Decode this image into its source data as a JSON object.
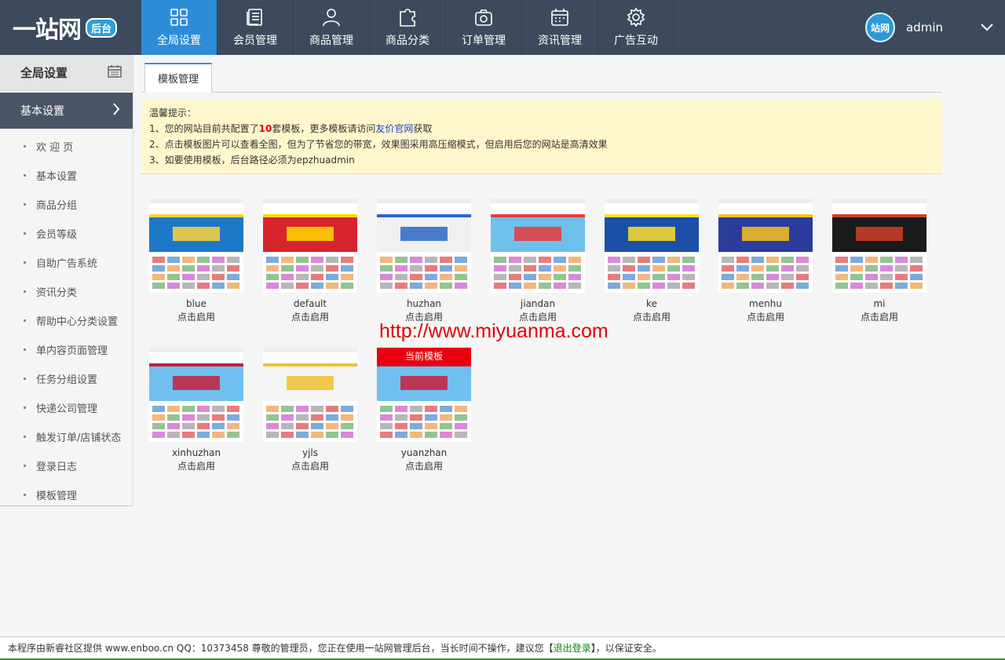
{
  "header": {
    "logo_text": "一站网",
    "logo_badge": "后台",
    "nav": [
      {
        "label": "全局设置",
        "icon": "grid-icon",
        "active": true
      },
      {
        "label": "会员管理",
        "icon": "document-list-icon",
        "active": false
      },
      {
        "label": "商品管理",
        "icon": "user-icon",
        "active": false
      },
      {
        "label": "商品分类",
        "icon": "puzzle-icon",
        "active": false
      },
      {
        "label": "订单管理",
        "icon": "camera-bag-icon",
        "active": false
      },
      {
        "label": "资讯管理",
        "icon": "calendar-icon",
        "active": false
      },
      {
        "label": "广告互动",
        "icon": "gear-icon",
        "active": false
      }
    ],
    "avatar_text": "站网",
    "username": "admin"
  },
  "sidebar": {
    "title": "全局设置",
    "group": "基本设置",
    "items": [
      "欢 迎 页",
      "基本设置",
      "商品分组",
      "会员等级",
      "自助广告系统",
      "资讯分类",
      "帮助中心分类设置",
      "单内容页面管理",
      "任务分组设置",
      "快递公司管理",
      "触发订单/店铺状态",
      "登录日志",
      "模板管理"
    ]
  },
  "main": {
    "tab": "模板管理",
    "notice": {
      "title": "温馨提示：",
      "line1_prefix": "1、您的网站目前共配置了",
      "line1_count": "10",
      "line1_mid": "套模板，更多模板请访问",
      "line1_link": "友价官网",
      "line1_suffix": "获取",
      "line2": "2、点击模板图片可以查看全图，但为了节省您的带宽，效果图采用高压缩模式，但启用后您的网站是高清效果",
      "line3": "3、如要使用模板，后台路径必须为epzhuadmin"
    },
    "templates": [
      {
        "name": "blue",
        "action": "点击启用",
        "current": false,
        "banner": "#1e78c8",
        "accent": "#ffd23c"
      },
      {
        "name": "default",
        "action": "点击启用",
        "current": false,
        "banner": "#d8242c",
        "accent": "#ffd800"
      },
      {
        "name": "huzhan",
        "action": "点击启用",
        "current": false,
        "banner": "#f0f0f0",
        "accent": "#2a66c8"
      },
      {
        "name": "jiandan",
        "action": "点击启用",
        "current": false,
        "banner": "#6ec0ea",
        "accent": "#e83a3a"
      },
      {
        "name": "ke",
        "action": "点击启用",
        "current": false,
        "banner": "#1b4fa8",
        "accent": "#ffde2a"
      },
      {
        "name": "menhu",
        "action": "点击启用",
        "current": false,
        "banner": "#2a3d9c",
        "accent": "#f8c020"
      },
      {
        "name": "mi",
        "action": "点击启用",
        "current": false,
        "banner": "#1a1a1a",
        "accent": "#d0402a"
      },
      {
        "name": "xinhuzhan",
        "action": "点击启用",
        "current": false,
        "banner": "#6fc0ee",
        "accent": "#c81e3c"
      },
      {
        "name": "yjls",
        "action": "点击启用",
        "current": false,
        "banner": "#f4f4f4",
        "accent": "#f0c030"
      },
      {
        "name": "yuanzhan",
        "action": "点击启用",
        "current": true,
        "current_label": "当前模板",
        "banner": "#6fc0ee",
        "accent": "#c81e3c"
      }
    ]
  },
  "watermark": "http://www.miyuanma.com",
  "footer": {
    "prefix": "本程序由新睿社区提供 www.enboo.cn QQ：10373458 尊敬的管理员，您正在使用一站网管理后台，当长时间不操作，建议您【",
    "logout": "退出登录",
    "suffix": "】，以保证安全。"
  }
}
